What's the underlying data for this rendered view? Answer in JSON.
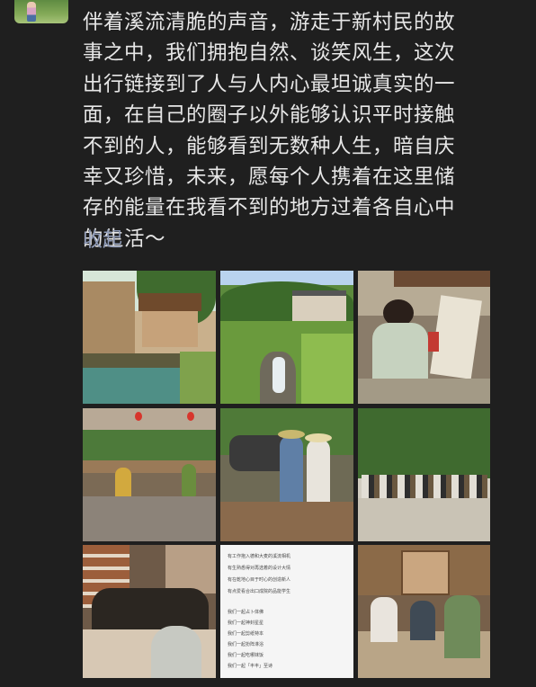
{
  "post": {
    "lines": [
      "伴着溪流清脆的声音，游走于新村民的故",
      "事之中，我们拥抱自然、谈笑风生，这次",
      "出行链接到了人与人内心最坦诚真实的一",
      "面，在自己的圈子以外能够认识平时接触",
      "不到的人，能够看到无数种人生，暗自庆",
      "幸又珍惜，未来，愿每个人携着在这里储",
      "存的能量在我看不到的地方过着各自心中",
      "的生活～"
    ],
    "collapse_label": "收起"
  },
  "photo8_note": {
    "lines": [
      "有工作抱入德和大麦的溪流相机",
      "有生熟悉得对再选着的设计大情",
      "有在乾地心目于时心的创造新人",
      "有点爱看合出口成院的品能学生",
      "",
      "我们一起占卜体佛",
      "我们一起神封星星",
      "我们一起剪纸特本",
      "我们一起扮阵淋浴",
      "我们一起吃哪妹饭",
      "我们一起「丰丰」至诗"
    ]
  }
}
